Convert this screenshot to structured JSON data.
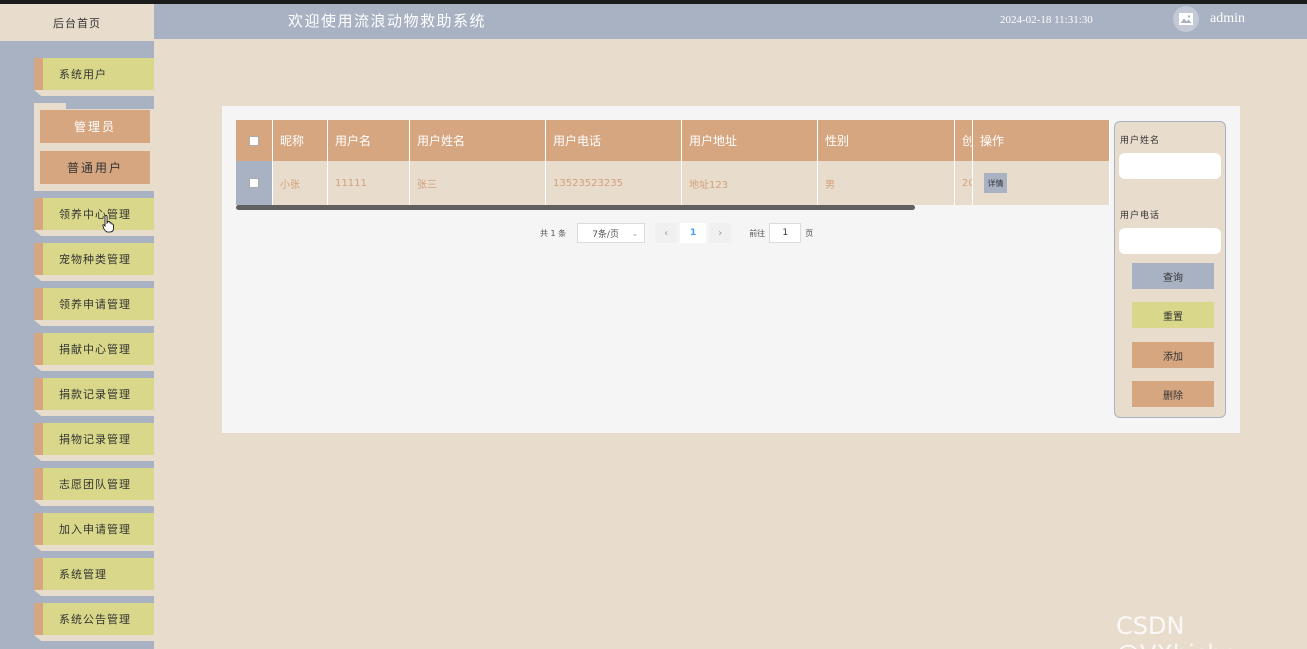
{
  "brand": {
    "label": "后台首页"
  },
  "header": {
    "title": "欢迎使用流浪动物救助系统",
    "datetime": "2024-02-18 11:31:30",
    "username": "admin"
  },
  "sidebar": {
    "items": [
      {
        "label": "系统用户"
      },
      {
        "label": "领养中心管理"
      },
      {
        "label": "宠物种类管理"
      },
      {
        "label": "领养申请管理"
      },
      {
        "label": "捐献中心管理"
      },
      {
        "label": "捐款记录管理"
      },
      {
        "label": "捐物记录管理"
      },
      {
        "label": "志愿团队管理"
      },
      {
        "label": "加入申请管理"
      },
      {
        "label": "系统管理"
      },
      {
        "label": "系统公告管理"
      }
    ],
    "submenu": [
      {
        "label": "管理员"
      },
      {
        "label": "普通用户"
      }
    ]
  },
  "table": {
    "columns": [
      "昵称",
      "用户名",
      "用户姓名",
      "用户电话",
      "用户地址",
      "性别",
      "创",
      "操作"
    ],
    "rows": [
      {
        "nickname": "小张",
        "username": "11111",
        "realname": "张三",
        "phone": "13523523235",
        "address": "地址123",
        "gender": "男",
        "created": "20",
        "action": "详情"
      }
    ]
  },
  "pager": {
    "total": "共 1 条",
    "page_size": "7条/页",
    "prev": "‹",
    "current": "1",
    "next": "›",
    "goto_label": "前往",
    "goto_value": "1",
    "page_suffix": "页"
  },
  "search": {
    "name_label": "用户姓名",
    "phone_label": "用户电话",
    "query": "查询",
    "reset": "重置",
    "add": "添加",
    "delete": "删除"
  },
  "colors": {
    "accent_brown": "#d6a680",
    "accent_yellow": "#d9d88a",
    "accent_blue": "#a8b2c2",
    "background": "#e8dccc"
  },
  "watermark": "CSDN @VXbishe"
}
